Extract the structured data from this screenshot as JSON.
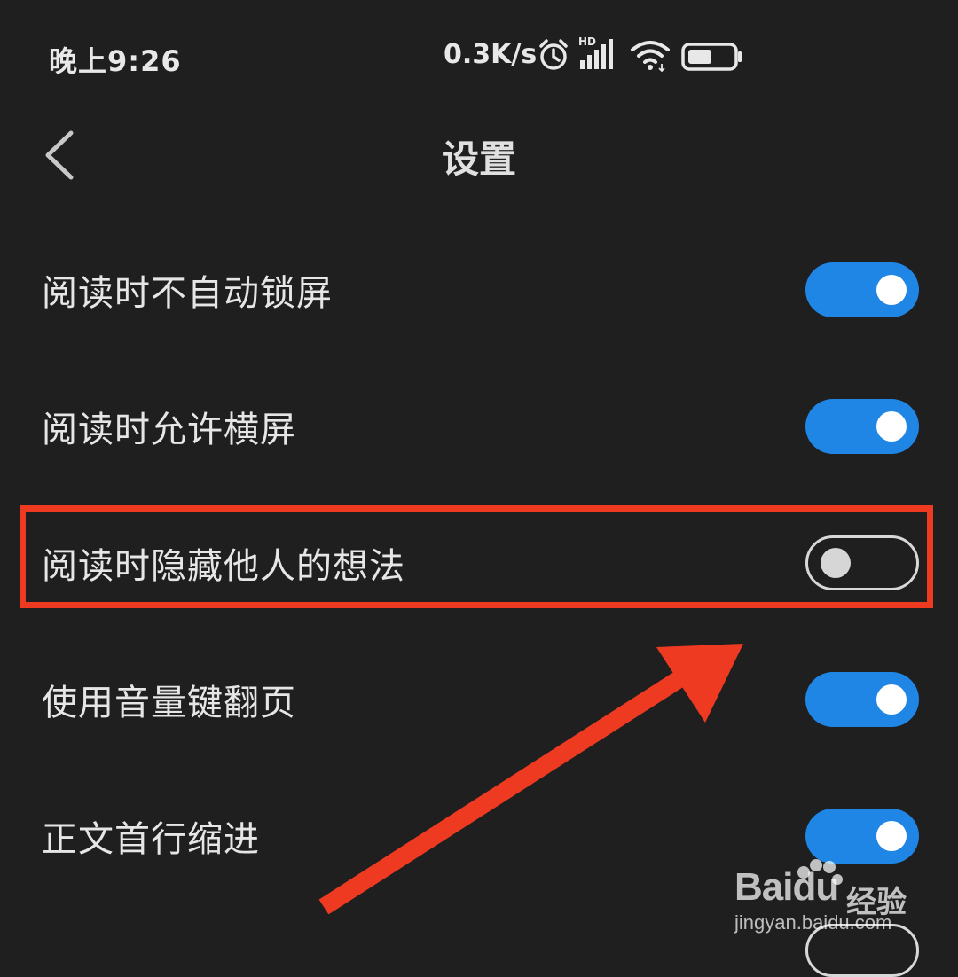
{
  "status_bar": {
    "time": "晚上9:26",
    "net_speed": "0.3K/s",
    "icons": [
      "alarm-icon",
      "hd-signal-icon",
      "wifi-icon",
      "battery-icon"
    ],
    "signal_badge": "HD"
  },
  "header": {
    "title": "设置",
    "back_icon": "chevron-left-icon"
  },
  "settings": [
    {
      "label": "阅读时不自动锁屏",
      "enabled": true
    },
    {
      "label": "阅读时允许横屏",
      "enabled": true
    },
    {
      "label": "阅读时隐藏他人的想法",
      "enabled": false,
      "highlighted": true
    },
    {
      "label": "使用音量键翻页",
      "enabled": true
    },
    {
      "label": "正文首行缩进",
      "enabled": true
    }
  ],
  "colors": {
    "background": "#1f1f1f",
    "toggle_on": "#1f86e6",
    "annotation": "#ef3a22"
  },
  "watermark": {
    "brand": "Baidu",
    "brand_cn": "经验",
    "url": "jingyan.baidu.com"
  }
}
